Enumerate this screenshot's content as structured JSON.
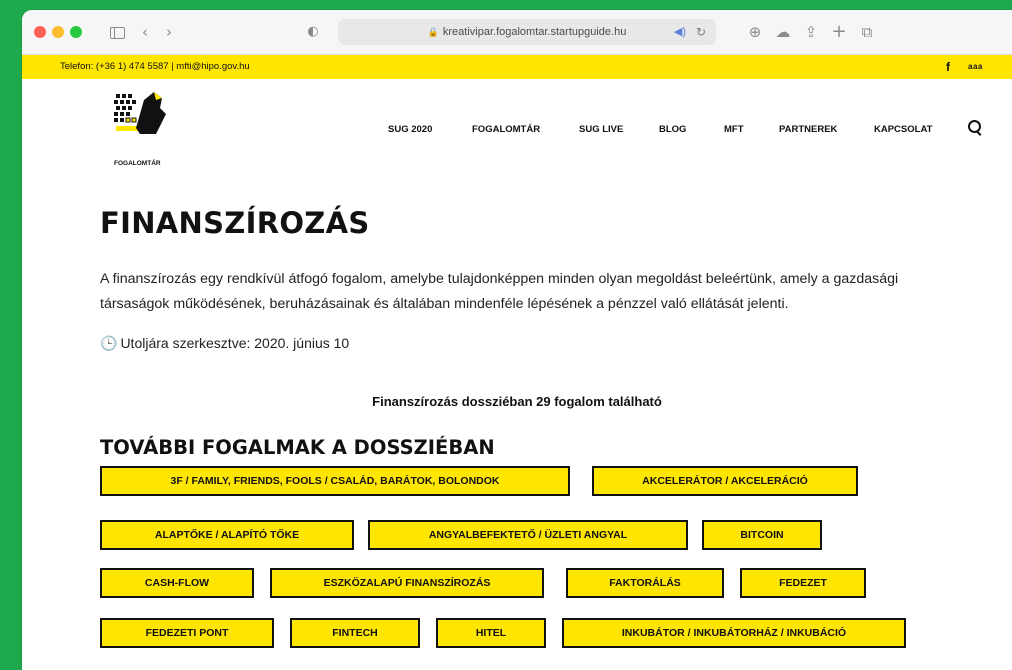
{
  "browser": {
    "url": "kreativipar.fogalomtar.startupguide.hu"
  },
  "topbar": {
    "contact": "Telefon: (+36 1) 474 5587 | mfti@hipo.gov.hu",
    "facebook": "f",
    "lang": "ааа"
  },
  "site": {
    "logo_caption": "FOGALOMTÁR",
    "nav": [
      "SUG 2020",
      "FOGALOMTÁR",
      "SUG LIVE",
      "BLOG",
      "MFT",
      "PARTNEREK",
      "KAPCSOLAT"
    ]
  },
  "main": {
    "title": "FINANSZÍROZÁS",
    "intro": "A finanszírozás egy rendkívül átfogó fogalom, amelybe tulajdonképpen minden olyan megoldást beleértünk, amely a gazdasági társaságok működésének, beruházásainak és általában mindenféle lépésének a pénzzel való ellátását jelenti.",
    "updated": "Utoljára szerkesztve: 2020. június 10",
    "count": "Finanszírozás dossziéban 29 fogalom található",
    "section_title": "TOVÁBBI FOGALMAK A DOSSZIÉBAN",
    "tags": [
      "3F / FAMILY, FRIENDS, FOOLS / CSALÁD, BARÁTOK, BOLONDOK",
      "AKCELERÁTOR / AKCELERÁCIÓ",
      "ALAPTŐKE / ALAPÍTÓ TŐKE",
      "ANGYALBEFEKTETŐ / ÜZLETI ANGYAL",
      "BITCOIN",
      "CASH-FLOW",
      "ESZKÖZALAPÚ FINANSZÍROZÁS",
      "FAKTORÁLÁS",
      "FEDEZET",
      "FEDEZETI PONT",
      "FINTECH",
      "HITEL",
      "INKUBÁTOR / INKUBÁTORHÁZ / INKUBÁCIÓ"
    ]
  },
  "colors": {
    "accent_yellow": "#ffe600",
    "background_green": "#1ea94c",
    "text": "#111111"
  }
}
